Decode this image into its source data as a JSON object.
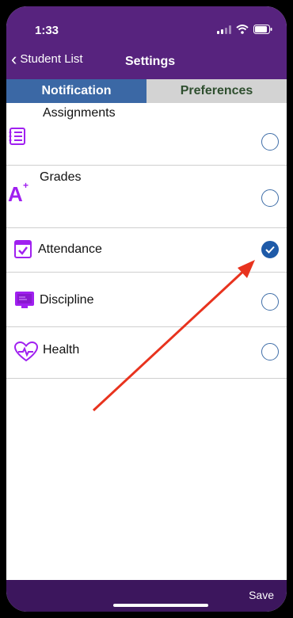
{
  "status": {
    "time": "1:33"
  },
  "nav": {
    "back_label": "Student List",
    "title": "Settings"
  },
  "tabs": [
    {
      "label": "Notification",
      "active": true
    },
    {
      "label": "Preferences",
      "active": false
    }
  ],
  "items": [
    {
      "label": "Assignments",
      "icon": "assignments-icon",
      "checked": false
    },
    {
      "label": "Grades",
      "icon": "grade-a-plus-icon",
      "checked": false
    },
    {
      "label": "Attendance",
      "icon": "attendance-icon",
      "checked": true
    },
    {
      "label": "Discipline",
      "icon": "discipline-icon",
      "checked": false
    },
    {
      "label": "Health",
      "icon": "health-heart-icon",
      "checked": false
    }
  ],
  "footer": {
    "save_label": "Save"
  },
  "colors": {
    "header": "#57237e",
    "active_tab": "#3b68a5",
    "inactive_tab": "#d3d3d3",
    "icon_purple": "#a020f0",
    "checked_radio": "#1e5aa8",
    "annotation_arrow": "#e8331e"
  }
}
